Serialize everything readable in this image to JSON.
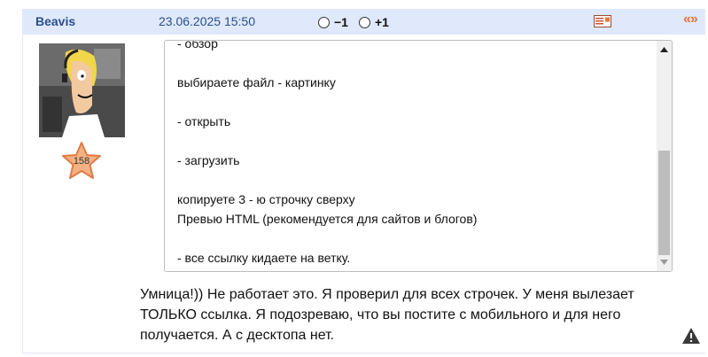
{
  "post": {
    "username": "Beavis",
    "datetime": "23.06.2025 15:50",
    "vote_minus_label": "−1",
    "vote_plus_label": "+1",
    "quote_label": "«»",
    "rating": "158",
    "code_lines": "- обзор\n\nвыбираете файл - картинку\n\n- открыть\n\n- загрузить\n\nкопируете 3 - ю строчку сверху\nПревью HTML (рекомендуется для сайтов и блогов)\n\n- все ссылку кидаете на ветку.",
    "message": "Умница!)) Не работает это. Я проверил для всех строчек. У меня вылезает ТОЛЬКО ссылка. Я подозреваю, что вы постите с мобильного и для него получается. А с десктопа нет.",
    "icons": {
      "message": "message-icon",
      "quote": "quote-icon",
      "report": "warning-icon",
      "rating": "star-icon",
      "scroll_up": "triangle-up-icon",
      "scroll_down": "triangle-down-icon"
    },
    "colors": {
      "header_bg": "#dfe9fb",
      "username": "#2a4f8e",
      "quote": "#e8743b",
      "star": "#f4b183"
    }
  }
}
